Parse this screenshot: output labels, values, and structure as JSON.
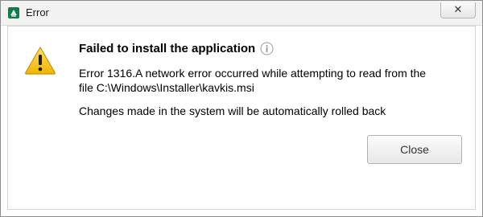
{
  "window": {
    "title": "Error",
    "close_glyph": "✕",
    "app_icon": "app-icon"
  },
  "dialog": {
    "heading": "Failed to install the application",
    "message_line1": "Error 1316.A network error occurred while attempting to read from the",
    "message_line2": "file C:\\Windows\\Installer\\kavkis.msi",
    "rollback_text": "Changes made in the system will be automatically rolled back",
    "close_button_label": "Close",
    "icons": [
      "warning-icon",
      "info-icon"
    ]
  },
  "colors": {
    "warning": "#f2c200",
    "info_ring": "#9a9a9a"
  }
}
